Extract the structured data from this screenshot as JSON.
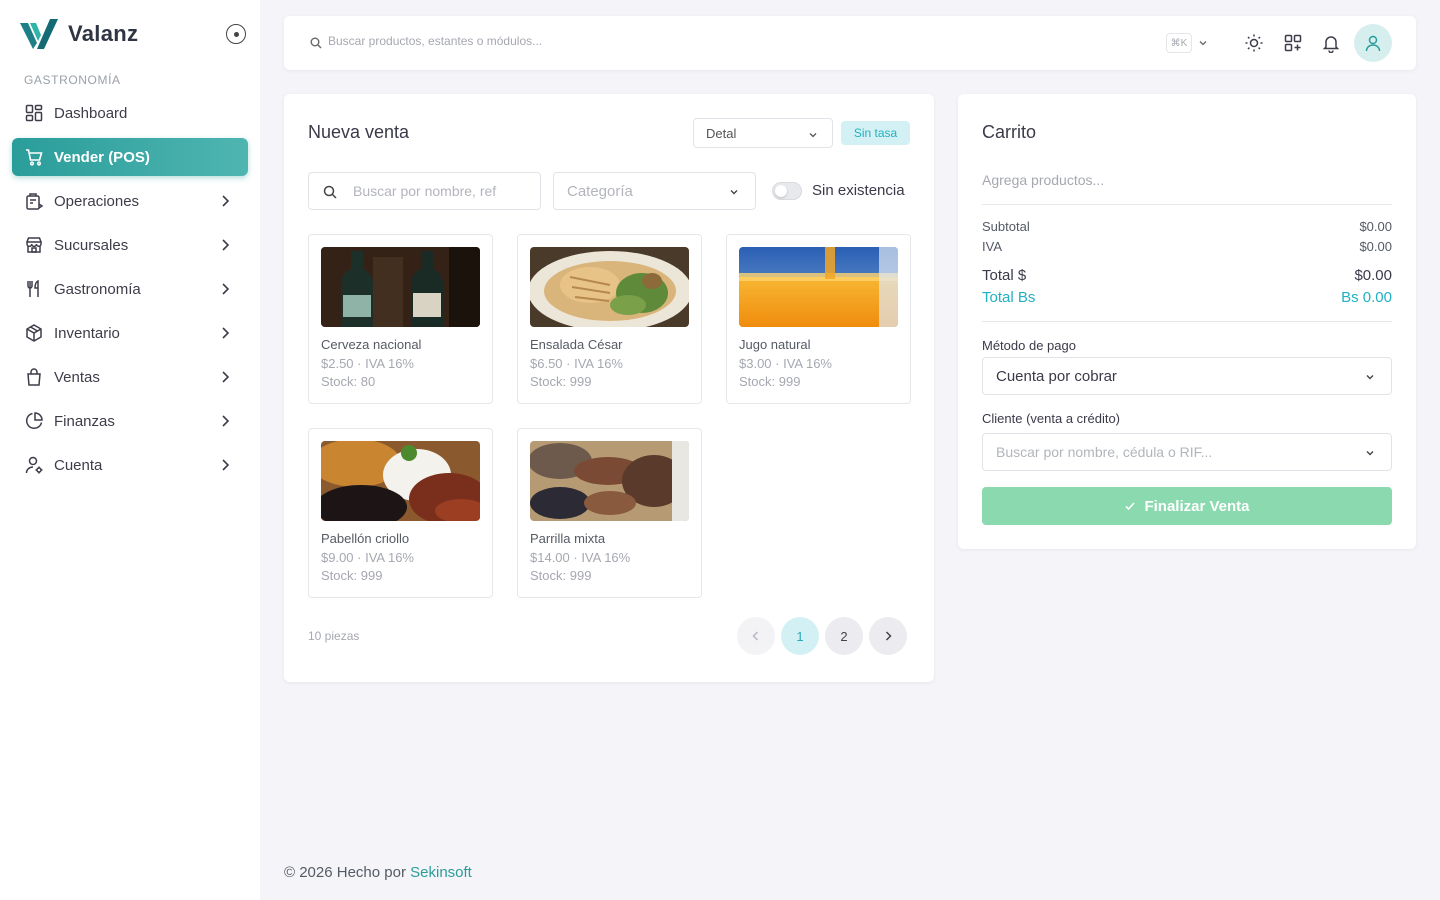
{
  "brand": {
    "name": "Valanz"
  },
  "sidebar": {
    "section": "GASTRONOMÍA",
    "items": [
      {
        "label": "Dashboard",
        "icon": "dashboard-icon",
        "active": false,
        "chevron": false
      },
      {
        "label": "Vender (POS)",
        "icon": "cart-icon",
        "active": true,
        "chevron": false
      },
      {
        "label": "Operaciones",
        "icon": "operations-icon",
        "active": false,
        "chevron": true
      },
      {
        "label": "Sucursales",
        "icon": "store-icon",
        "active": false,
        "chevron": true
      },
      {
        "label": "Gastronomía",
        "icon": "utensils-icon",
        "active": false,
        "chevron": true
      },
      {
        "label": "Inventario",
        "icon": "box-icon",
        "active": false,
        "chevron": true
      },
      {
        "label": "Ventas",
        "icon": "bag-icon",
        "active": false,
        "chevron": true
      },
      {
        "label": "Finanzas",
        "icon": "pie-chart-icon",
        "active": false,
        "chevron": true
      },
      {
        "label": "Cuenta",
        "icon": "user-settings-icon",
        "active": false,
        "chevron": true
      }
    ]
  },
  "topbar": {
    "search_placeholder": "Buscar productos, estantes o módulos...",
    "shortcut": "⌘K"
  },
  "sale": {
    "title": "Nueva venta",
    "price_list": "Detal",
    "rate_badge": "Sin tasa",
    "search_placeholder": "Buscar por nombre, ref",
    "category_placeholder": "Categoría",
    "stock_toggle_label": "Sin existencia",
    "products": [
      {
        "name": "Cerveza nacional",
        "price": "$2.50 · IVA 16%",
        "stock": "Stock: 80"
      },
      {
        "name": "Ensalada César",
        "price": "$6.50 · IVA 16%",
        "stock": "Stock: 999"
      },
      {
        "name": "Jugo natural",
        "price": "$3.00 · IVA 16%",
        "stock": "Stock: 999"
      },
      {
        "name": "Pabellón criollo",
        "price": "$9.00 · IVA 16%",
        "stock": "Stock: 999"
      },
      {
        "name": "Parrilla mixta",
        "price": "$14.00 · IVA 16%",
        "stock": "Stock: 999"
      }
    ],
    "count_label": "10 piezas",
    "pages": [
      "1",
      "2"
    ],
    "current_page": "1"
  },
  "cart": {
    "title": "Carrito",
    "empty_text": "Agrega productos...",
    "subtotal_label": "Subtotal",
    "subtotal_value": "$0.00",
    "iva_label": "IVA",
    "iva_value": "$0.00",
    "total_usd_label": "Total $",
    "total_usd_value": "$0.00",
    "total_bs_label": "Total Bs",
    "total_bs_value": "Bs 0.00",
    "payment_label": "Método de pago",
    "payment_value": "Cuenta por cobrar",
    "client_label": "Cliente (venta a crédito)",
    "client_placeholder": "Buscar por nombre, cédula o RIF...",
    "finish_label": "Finalizar Venta"
  },
  "footer": {
    "text": "© 2026 Hecho por ",
    "link": "Sekinsoft"
  },
  "colors": {
    "accent": "#2a9d9a",
    "badge_bg": "#d3f1f4",
    "badge_text": "#21b1c2",
    "finish_button": "#8ad9af"
  }
}
